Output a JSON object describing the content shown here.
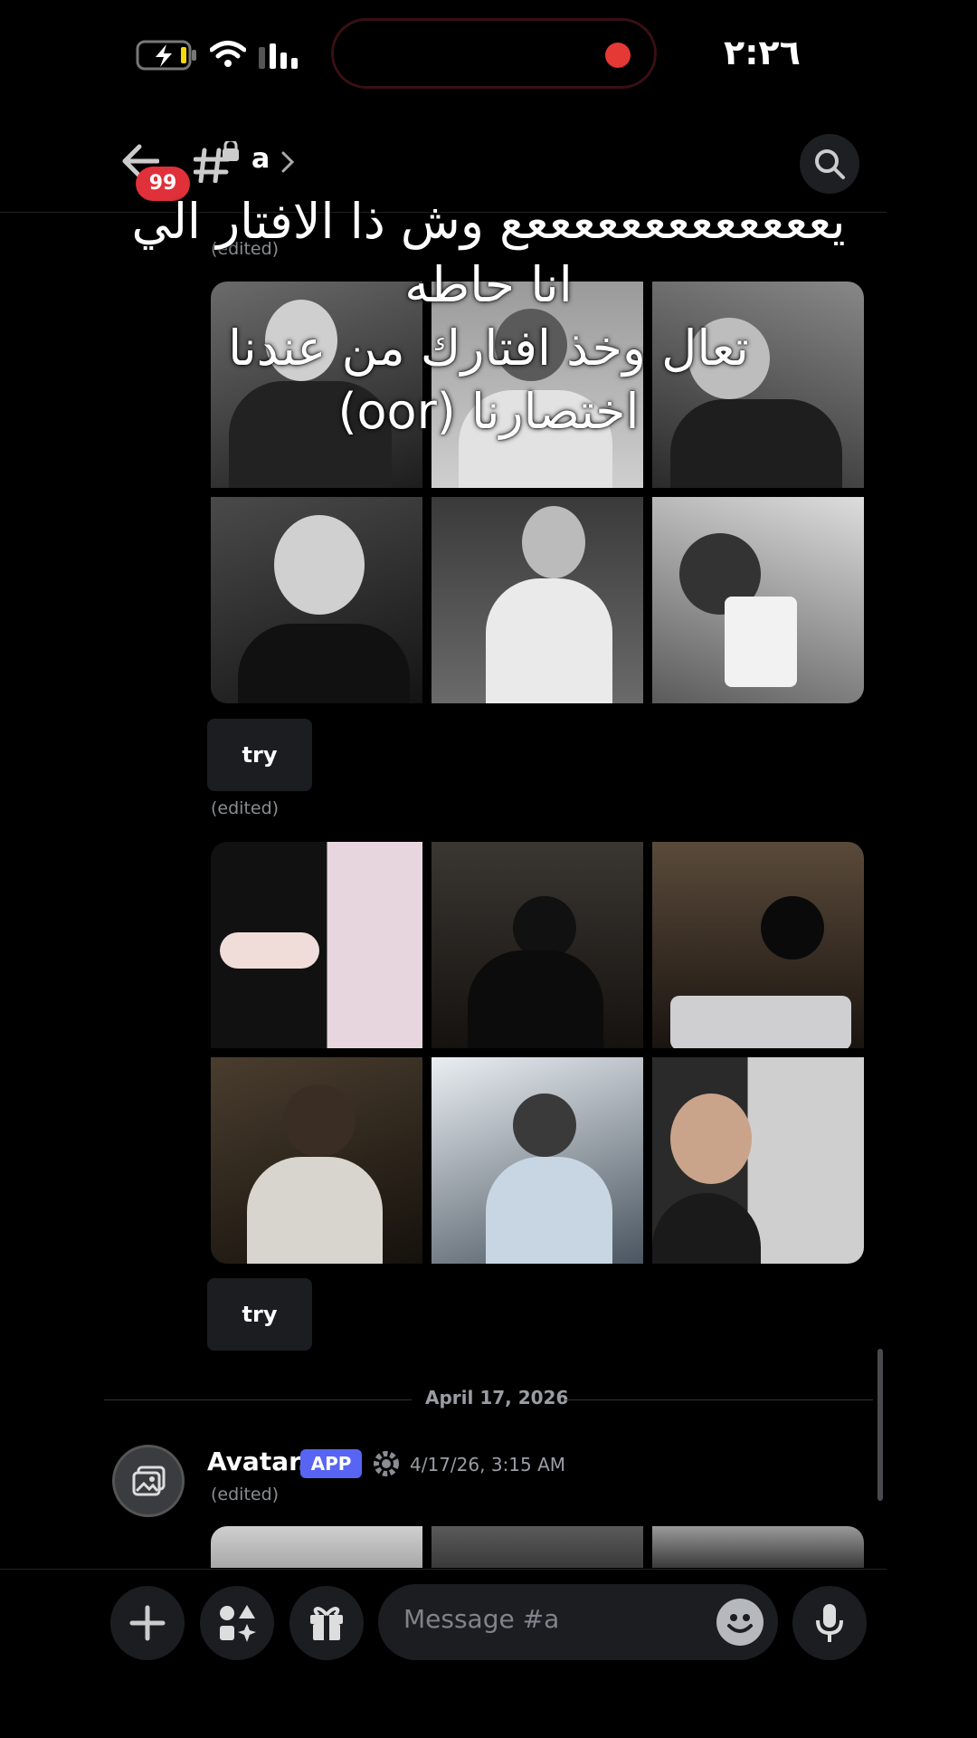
{
  "status_bar": {
    "time": "٢:٢٦"
  },
  "header": {
    "channel_name": "a",
    "unread_badge": "99"
  },
  "overlay_text": {
    "line1": "يعععععععععععععع وش ذا الافتار الي",
    "line2": "انا حاطه",
    "line3": "تعال وخذ افتارك من عندنا",
    "line4": "اختصارنا (oor)"
  },
  "messages": {
    "edited_label": "(edited)",
    "try_label": "try"
  },
  "date_divider": "April 17, 2026",
  "avatar_message": {
    "author": "Avatar.",
    "app_badge": "APP",
    "timestamp": "4/17/26, 3:15 AM",
    "edited_label": "(edited)"
  },
  "composer": {
    "placeholder": "Message #a"
  },
  "colors": {
    "accent": "#5865f2",
    "danger": "#e0303a",
    "background": "#000000"
  }
}
